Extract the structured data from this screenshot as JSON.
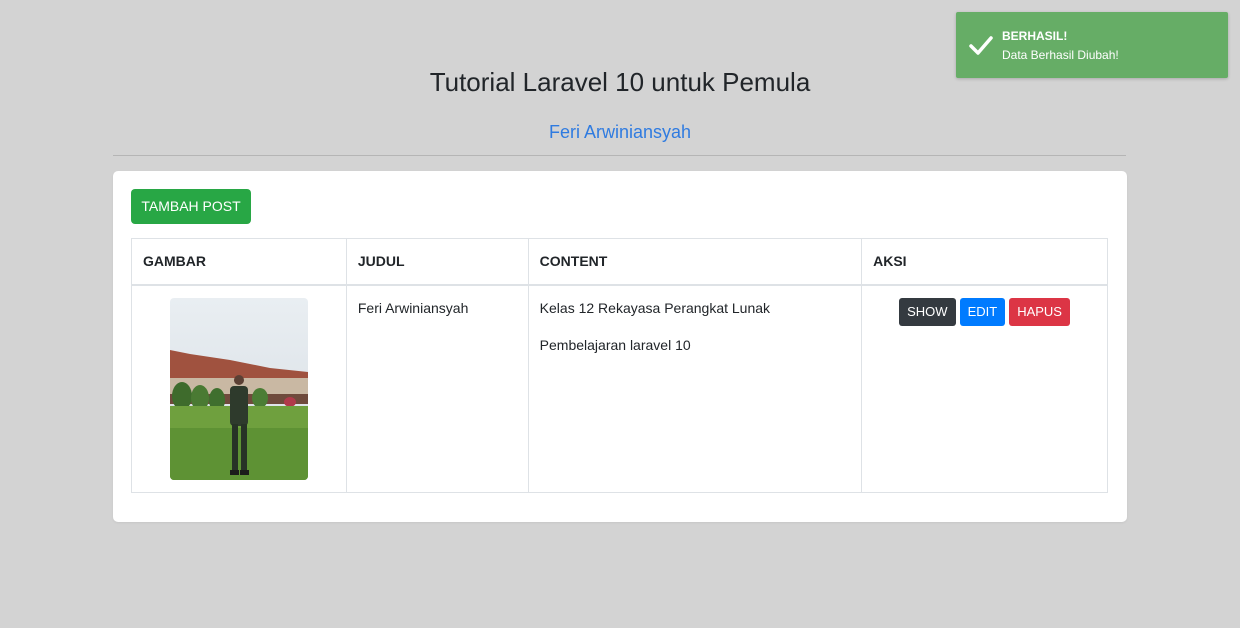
{
  "header": {
    "title": "Tutorial Laravel 10 untuk Pemula",
    "author_link": "Feri Arwiniansyah"
  },
  "toolbar": {
    "add_label": "TAMBAH POST"
  },
  "table": {
    "columns": [
      "GAMBAR",
      "JUDUL",
      "CONTENT",
      "AKSI"
    ],
    "rows": [
      {
        "title": "Feri Arwiniansyah",
        "content": [
          "Kelas 12 Rekayasa Perangkat Lunak",
          "Pembelajaran laravel 10"
        ],
        "actions": {
          "show": "SHOW",
          "edit": "EDIT",
          "delete": "HAPUS"
        }
      }
    ]
  },
  "toast": {
    "title": "BERHASIL!",
    "message": "Data Berhasil Diubah!",
    "icon": "check-icon"
  },
  "colors": {
    "background": "#d3d3d3",
    "success": "#28a745",
    "toast": "#66ad66",
    "link": "#2f7be0",
    "show": "#343a40",
    "edit": "#007bff",
    "delete": "#dc3545"
  }
}
